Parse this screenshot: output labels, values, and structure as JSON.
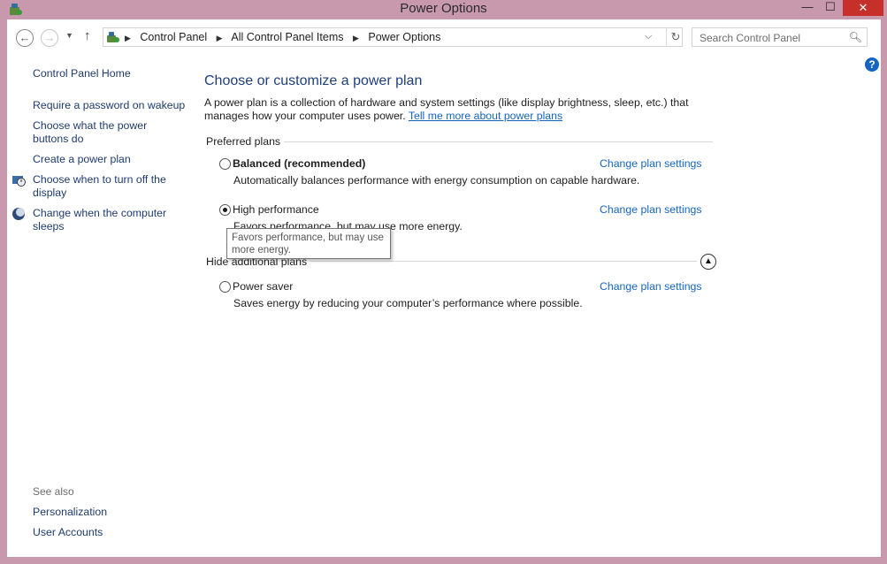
{
  "window": {
    "title": "Power Options",
    "controls": {
      "minimize": "—",
      "maximize": "☐",
      "close": "✕"
    }
  },
  "address_bar": {
    "crumbs": [
      "Control Panel",
      "All Control Panel Items",
      "Power Options"
    ]
  },
  "search": {
    "placeholder": "Search Control Panel"
  },
  "sidebar": {
    "home": "Control Panel Home",
    "links": [
      "Require a password on wakeup",
      "Choose what the power buttons do",
      "Create a power plan",
      "Choose when to turn off the display",
      "Change when the computer sleeps"
    ],
    "see_also_title": "See also",
    "see_also": [
      "Personalization",
      "User Accounts"
    ]
  },
  "main": {
    "title": "Choose or customize a power plan",
    "description": "A power plan is a collection of hardware and system settings (like display brightness, sleep, etc.) that manages how your computer uses power.",
    "learn_more_link": "Tell me more about power plans",
    "preferred_header": "Preferred plans",
    "additional_header": "Hide additional plans",
    "change_link": "Change plan settings",
    "plans": [
      {
        "name": "Balanced (recommended)",
        "desc": "Automatically balances performance with energy consumption on capable hardware.",
        "selected": false
      },
      {
        "name": "High performance",
        "desc": "Favors performance, but may use more energy.",
        "selected": true
      },
      {
        "name": "Power saver",
        "desc": "Saves energy by reducing your computer’s performance where possible.",
        "selected": false
      }
    ],
    "tooltip": "Favors performance, but may use more energy."
  },
  "colors": {
    "accent_link": "#1565c0",
    "title": "#1f3f7a",
    "frame": "#c899ad",
    "close": "#c7302a"
  }
}
